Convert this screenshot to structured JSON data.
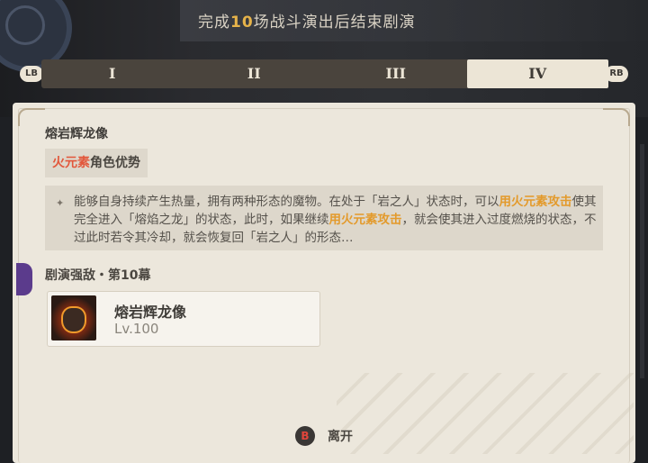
{
  "header": {
    "objective_prefix": "完成",
    "objective_number": "10",
    "objective_suffix": "场战斗演出后结束剧演"
  },
  "tabbar": {
    "left_button": "LB",
    "right_button": "RB",
    "tabs": [
      {
        "label": "I",
        "active": false
      },
      {
        "label": "II",
        "active": false
      },
      {
        "label": "III",
        "active": false
      },
      {
        "label": "IV",
        "active": true
      }
    ]
  },
  "boss": {
    "title": "熔岩辉龙像",
    "advantage_element": "火元素",
    "advantage_suffix": "角色优势",
    "description": {
      "part1": "能够自身持续产生热量，拥有两种形态的魔物。在处于「岩之人」状态时，可以",
      "hl1": "用火元素攻击",
      "part2": "使其完全进入「熔焰之龙」的状态，此时，如果继续",
      "hl2": "用火元素攻击",
      "part3": "，就会使其进入过度燃烧的状态，不过此时若令其冷却，就会恢复回「岩之人」的形态…"
    }
  },
  "section": {
    "title": "剧演强敌・第10幕"
  },
  "enemy": {
    "name": "熔岩辉龙像",
    "level": "Lv.100"
  },
  "footer": {
    "button_glyph": "B",
    "leave_label": "离开"
  },
  "colors": {
    "highlight": "#e39a2b",
    "pyro": "#e2573b",
    "panel": "#ece7dc",
    "tab_bar": "#4a443d"
  }
}
